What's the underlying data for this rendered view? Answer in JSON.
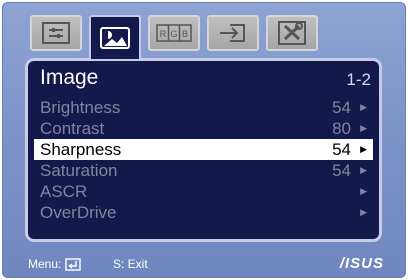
{
  "tabs": [
    {
      "icon": "adjust-panel-icon",
      "active": false
    },
    {
      "icon": "image-icon",
      "active": true
    },
    {
      "icon": "rgb-icon",
      "label": "RGB",
      "active": false
    },
    {
      "icon": "input-select-icon",
      "active": false
    },
    {
      "icon": "tools-icon",
      "active": false
    }
  ],
  "panel": {
    "title": "Image",
    "page": "1-2",
    "items": [
      {
        "label": "Brightness",
        "value": "54",
        "arrow": "▶"
      },
      {
        "label": "Contrast",
        "value": "80",
        "arrow": "▶"
      },
      {
        "label": "Sharpness",
        "value": "54",
        "arrow": "▶",
        "selected": true
      },
      {
        "label": "Saturation",
        "value": "54",
        "arrow": "▶"
      },
      {
        "label": "ASCR",
        "value": "",
        "arrow": "▶"
      },
      {
        "label": "OverDrive",
        "value": "",
        "arrow": "▶"
      }
    ]
  },
  "footer": {
    "menu_label": "Menu:",
    "exit_label": "S: Exit",
    "brand": "/ISUS"
  },
  "colors": {
    "background": "#7d94c9",
    "panel": "#13194a",
    "selected_row": "#ffffff",
    "inactive_text": "#7f869f"
  }
}
